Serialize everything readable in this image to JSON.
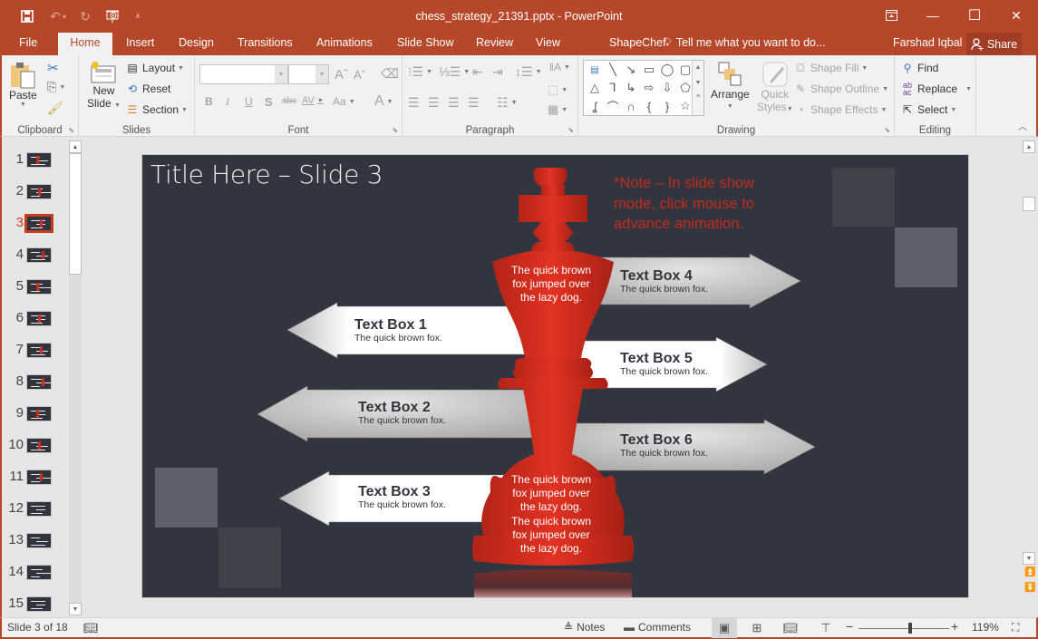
{
  "window": {
    "title": "chess_strategy_21391.pptx - PowerPoint",
    "quick_access": [
      {
        "name": "save-icon",
        "glyph": "💾"
      },
      {
        "name": "undo-icon",
        "glyph": "↶"
      },
      {
        "name": "redo-icon",
        "glyph": "↻"
      },
      {
        "name": "start-slideshow-icon",
        "glyph": "▷"
      },
      {
        "name": "customize-qat-icon",
        "glyph": "≡"
      }
    ],
    "controls": {
      "ribbon_display": "⭱",
      "minimize": "—",
      "maximize": "☐",
      "close": "✕"
    }
  },
  "tabs": [
    {
      "label": "File"
    },
    {
      "label": "Home",
      "active": true
    },
    {
      "label": "Insert"
    },
    {
      "label": "Design"
    },
    {
      "label": "Transitions"
    },
    {
      "label": "Animations"
    },
    {
      "label": "Slide Show"
    },
    {
      "label": "Review"
    },
    {
      "label": "View"
    },
    {
      "label": "ShapeChef"
    }
  ],
  "tell_me": "Tell me what you want to do...",
  "user_name": "Farshad Iqbal",
  "share_label": "Share",
  "ribbon": {
    "clipboard": {
      "label": "Clipboard",
      "paste": "Paste"
    },
    "slides": {
      "label": "Slides",
      "new_slide_1": "New",
      "new_slide_2": "Slide",
      "layout": "Layout",
      "reset": "Reset",
      "section": "Section"
    },
    "font": {
      "label": "Font",
      "font_name": "",
      "font_size": "",
      "bold": "B",
      "italic": "I",
      "underline": "U",
      "shadow": "S",
      "strike": "abc",
      "spacing": "AV",
      "case": "Aa",
      "grow": "Aˆ",
      "shrink": "Aˇ",
      "color": "A"
    },
    "paragraph": {
      "label": "Paragraph"
    },
    "drawing": {
      "label": "Drawing",
      "arrange": "Arrange",
      "quick_styles_1": "Quick",
      "quick_styles_2": "Styles",
      "shape_fill": "Shape Fill",
      "shape_outline": "Shape Outline",
      "shape_effects": "Shape Effects"
    },
    "editing": {
      "label": "Editing",
      "find": "Find",
      "replace": "Replace",
      "select": "Select"
    }
  },
  "thumbnails": [
    {
      "num": "1"
    },
    {
      "num": "2"
    },
    {
      "num": "3",
      "active": true
    },
    {
      "num": "4"
    },
    {
      "num": "5"
    },
    {
      "num": "6"
    },
    {
      "num": "7"
    },
    {
      "num": "8"
    },
    {
      "num": "9"
    },
    {
      "num": "10"
    },
    {
      "num": "11"
    },
    {
      "num": "12"
    },
    {
      "num": "13"
    },
    {
      "num": "14"
    },
    {
      "num": "15"
    }
  ],
  "slide": {
    "title": "Title Here – Slide 3",
    "note": "*Note – In slide show mode, click mouse to advance animation.",
    "king_text_top": [
      "The quick brown",
      "fox jumped over",
      "the lazy dog."
    ],
    "king_text_bottom": [
      "The quick brown",
      "fox jumped over",
      "the lazy dog.",
      "The quick brown",
      "fox jumped over",
      "the lazy dog."
    ],
    "text_boxes": [
      {
        "title": "Text Box 1",
        "body": "The quick brown fox."
      },
      {
        "title": "Text Box 2",
        "body": "The quick brown fox."
      },
      {
        "title": "Text Box 3",
        "body": "The quick brown fox."
      },
      {
        "title": "Text Box 4",
        "body": "The quick brown fox."
      },
      {
        "title": "Text Box 5",
        "body": "The quick brown fox."
      },
      {
        "title": "Text Box 6",
        "body": "The quick brown fox."
      }
    ],
    "colors": {
      "background": "#31353f",
      "king_red": "#d42e1e",
      "note_red": "#c42b1c"
    }
  },
  "status": {
    "slide_info": "Slide 3 of 18",
    "notes": "Notes",
    "comments": "Comments",
    "zoom": "119%",
    "zoom_percent": 119
  }
}
